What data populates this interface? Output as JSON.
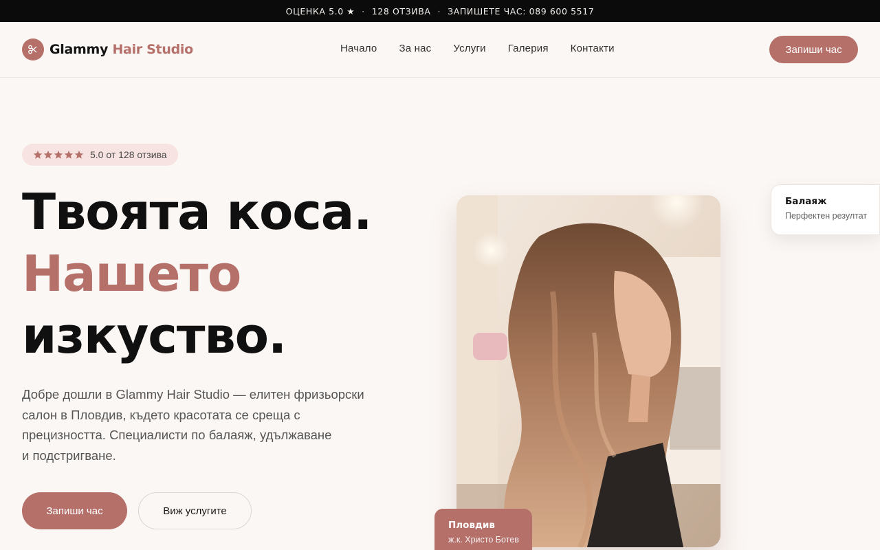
{
  "topbar": {
    "rating": "ОЦЕНКА 5.0 ★",
    "reviews": "128 ОТЗИВА",
    "phone": "ЗАПИШЕТЕ ЧАС: 089 600 5517",
    "separator": "·"
  },
  "header": {
    "logo_icon": "scissors-icon",
    "brand_part1": "Glammy",
    "brand_part2": "Hair Studio",
    "nav": [
      "Начало",
      "За нас",
      "Услуги",
      "Галерия",
      "Контакти"
    ],
    "cta": "Запиши час"
  },
  "hero": {
    "rating_pill": {
      "stars": 5,
      "text": "5.0 от 128 отзива"
    },
    "headline_1": "Твоята коса.",
    "headline_2": "Нашето",
    "headline_3": "изкуство.",
    "lead_lines": [
      "Добре дошли в Glammy Hair Studio — елитен фризьорски",
      "салон в Пловдив, където красотата се среща с",
      "прецизността. Специалисти по балаяж, удължаване",
      "и подстригване."
    ],
    "primary_button": "Запиши час",
    "secondary_button": "Виж услугите"
  },
  "image_cards": {
    "service_title": "Балаяж",
    "service_sub": "Перфектен резултат",
    "location_title": "Пловдив",
    "location_sub": "ж.к. Христо Ботев"
  },
  "colors": {
    "accent": "#b5706a",
    "background": "#fbf7f4",
    "topbar": "#0b0b0b",
    "pill": "#f7e3e1"
  }
}
